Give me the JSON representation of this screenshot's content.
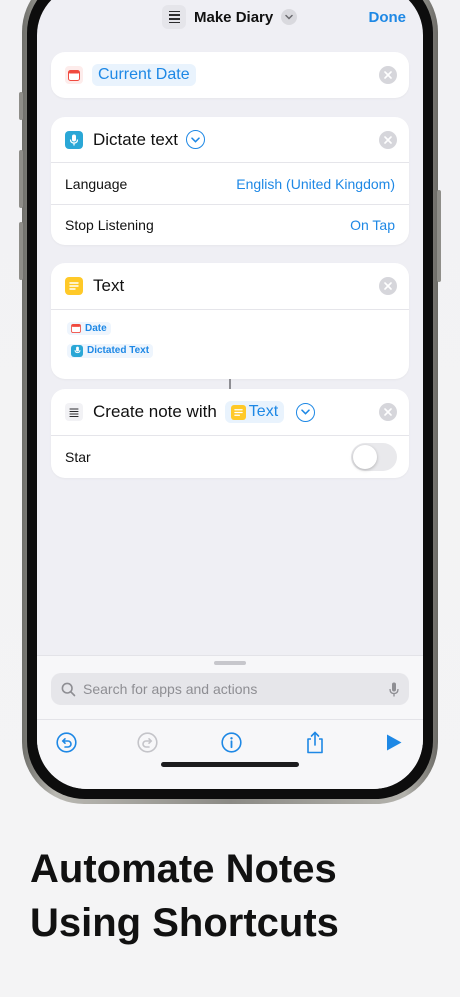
{
  "header": {
    "title": "Make Diary",
    "done_label": "Done"
  },
  "actions": {
    "current_date": {
      "label": "Current Date"
    },
    "dictate": {
      "title": "Dictate text",
      "rows": [
        {
          "label": "Language",
          "value": "English (United Kingdom)"
        },
        {
          "label": "Stop Listening",
          "value": "On Tap"
        }
      ]
    },
    "text": {
      "title": "Text",
      "tokens": [
        "Date",
        "Dictated Text"
      ]
    },
    "create_note": {
      "title": "Create note with",
      "token": "Text",
      "star_label": "Star",
      "star_on": false
    }
  },
  "search": {
    "placeholder": "Search for apps and actions"
  },
  "tagline": {
    "line1": "Automate Notes",
    "line2": "Using Shortcuts"
  },
  "colors": {
    "accent": "#1e88e5",
    "calendar": "#f04a3f",
    "dictate": "#2aa7d6",
    "text_yellow": "#ffc928"
  }
}
